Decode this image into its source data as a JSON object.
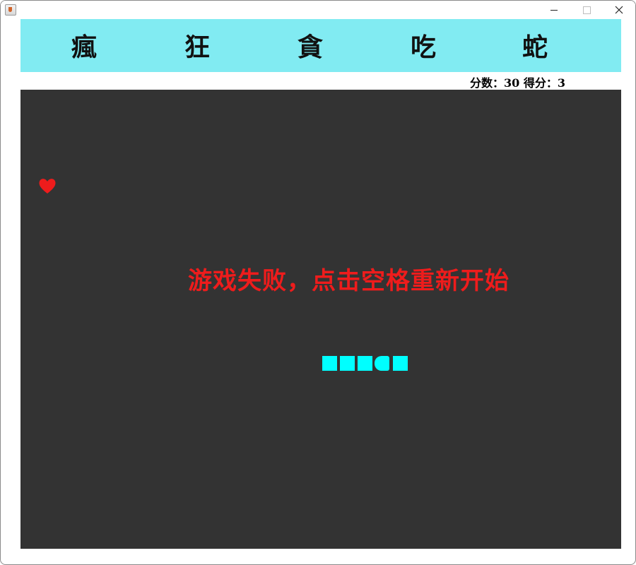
{
  "window": {
    "icon": "java-cup-icon"
  },
  "header": {
    "title_chars": [
      "瘋",
      "狂",
      "貪",
      "吃",
      "蛇"
    ],
    "background": "#81ebf2"
  },
  "status": {
    "score_text": "分数：30 得分：3"
  },
  "board": {
    "background": "#333333",
    "message": "游戏失败，点击空格重新开始",
    "message_color": "#ee1c1c",
    "food_icon": "heart-icon",
    "food_color": "#ee1c1c",
    "snake_color": "#00ffff",
    "snake_length": 5
  }
}
